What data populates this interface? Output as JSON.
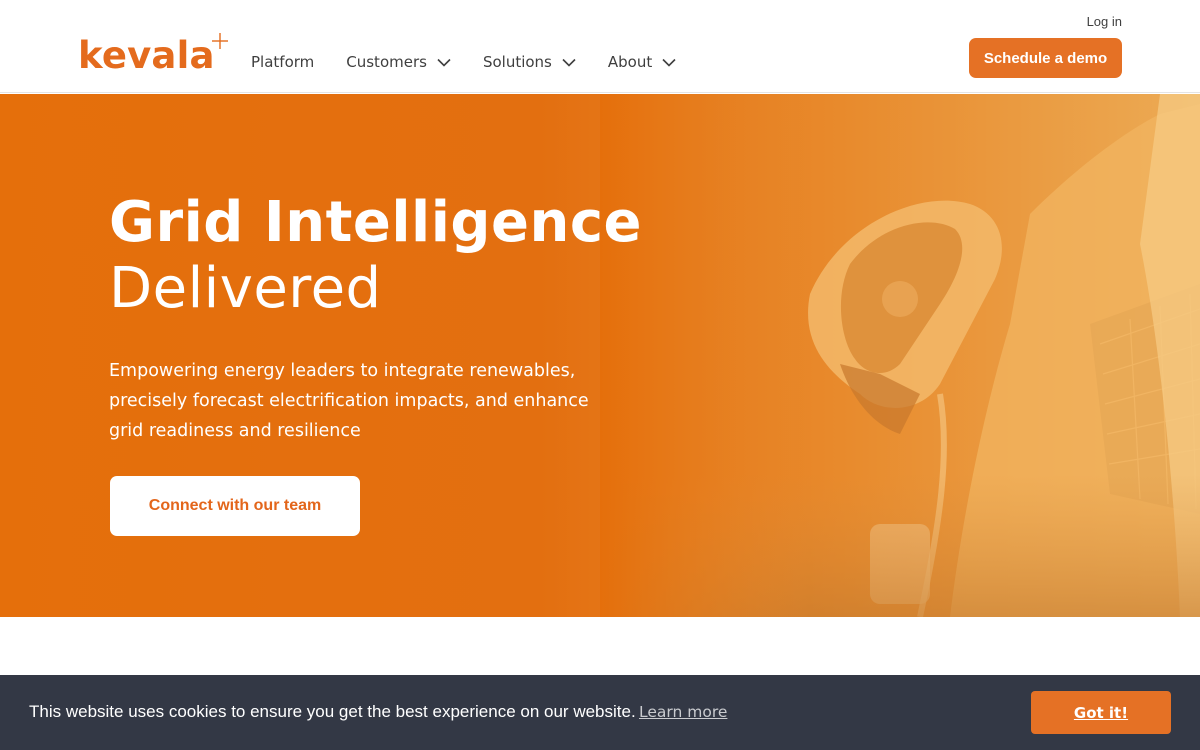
{
  "colors": {
    "brand_orange": "#e57125",
    "hero_orange": "#e56f0b",
    "cookie_bar": "#333845",
    "nav_text": "#3f3f3f"
  },
  "header": {
    "logo_text": "kevala",
    "nav": [
      {
        "label": "Platform",
        "has_dropdown": false,
        "icon": ""
      },
      {
        "label": "Customers",
        "has_dropdown": true,
        "icon": "chevron-down-icon"
      },
      {
        "label": "Solutions",
        "has_dropdown": true,
        "icon": "chevron-down-icon"
      },
      {
        "label": "About",
        "has_dropdown": true,
        "icon": "chevron-down-icon"
      }
    ],
    "login_label": "Log in",
    "demo_label": "Schedule a demo"
  },
  "hero": {
    "title_line1": "Grid Intelligence",
    "title_line2": "Delivered",
    "subtitle": "Empowering energy leaders to integrate renewables, precisely forecast electrification impacts, and enhance grid readiness and resilience",
    "cta_label": "Connect with our team",
    "image_icon": "ev-charger-solar-photo"
  },
  "cookie": {
    "message": "This website uses cookies to ensure you get the best experience on our website.",
    "learn_more": "Learn more",
    "accept": "Got it!"
  }
}
